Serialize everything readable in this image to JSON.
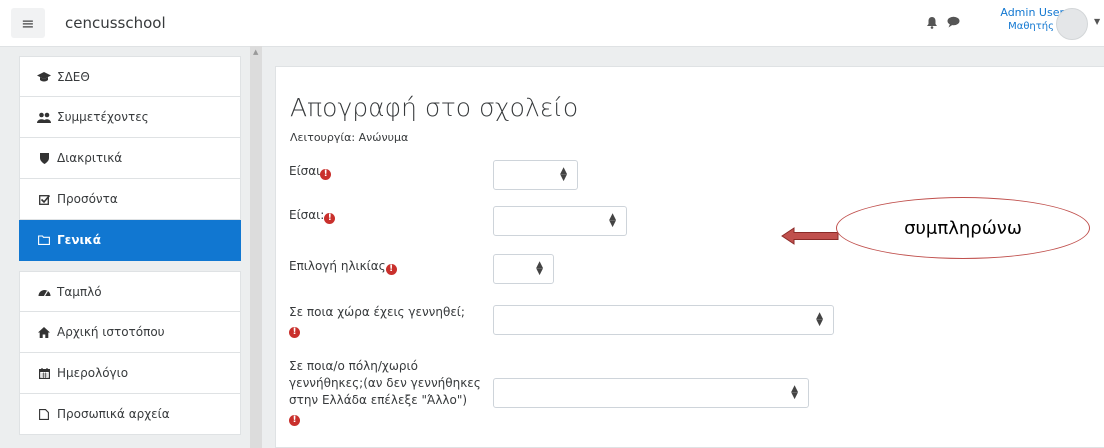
{
  "navbar": {
    "site_name": "cencusschool",
    "menu_icon": "hamburger-icon",
    "user_name": "Admin User",
    "user_role": "Μαθητής"
  },
  "sidebar": {
    "items": [
      {
        "label": "ΣΔΕΘ",
        "icon": "graduation-cap-icon"
      },
      {
        "label": "Συμμετέχοντες",
        "icon": "users-icon"
      },
      {
        "label": "Διακριτικά",
        "icon": "shield-icon"
      },
      {
        "label": "Προσόντα",
        "icon": "checkbox-icon"
      },
      {
        "label": "Γενικά",
        "icon": "folder-icon",
        "active": true
      }
    ],
    "items2": [
      {
        "label": "Ταμπλό",
        "icon": "dashboard-icon"
      },
      {
        "label": "Αρχική ιστοτόπου",
        "icon": "home-icon"
      },
      {
        "label": "Ημερολόγιο",
        "icon": "calendar-icon"
      },
      {
        "label": "Προσωπικά αρχεία",
        "icon": "file-icon"
      }
    ]
  },
  "main": {
    "title": "Απογραφή στο σχολείο",
    "mode": "Λειτουργία: Ανώνυμα",
    "questions": [
      {
        "label": "Είσαι"
      },
      {
        "label": "Είσαι:"
      },
      {
        "label": "Επιλογή ηλικίας"
      },
      {
        "label": "Σε ποια χώρα έχεις γεννηθεί;"
      },
      {
        "label_lines": [
          "Σε ποια/ο πόλη/χωριό",
          "γεννήθηκες;(αν δεν γεννήθηκες",
          "στην Ελλάδα επέλεξε \"Άλλο\")"
        ]
      }
    ],
    "required_mark": "!"
  },
  "annotation": {
    "text": "συμπληρώνω",
    "arrow_color": "#c0504d"
  },
  "colors": {
    "primary": "#1177d1",
    "required": "#c9302c"
  }
}
